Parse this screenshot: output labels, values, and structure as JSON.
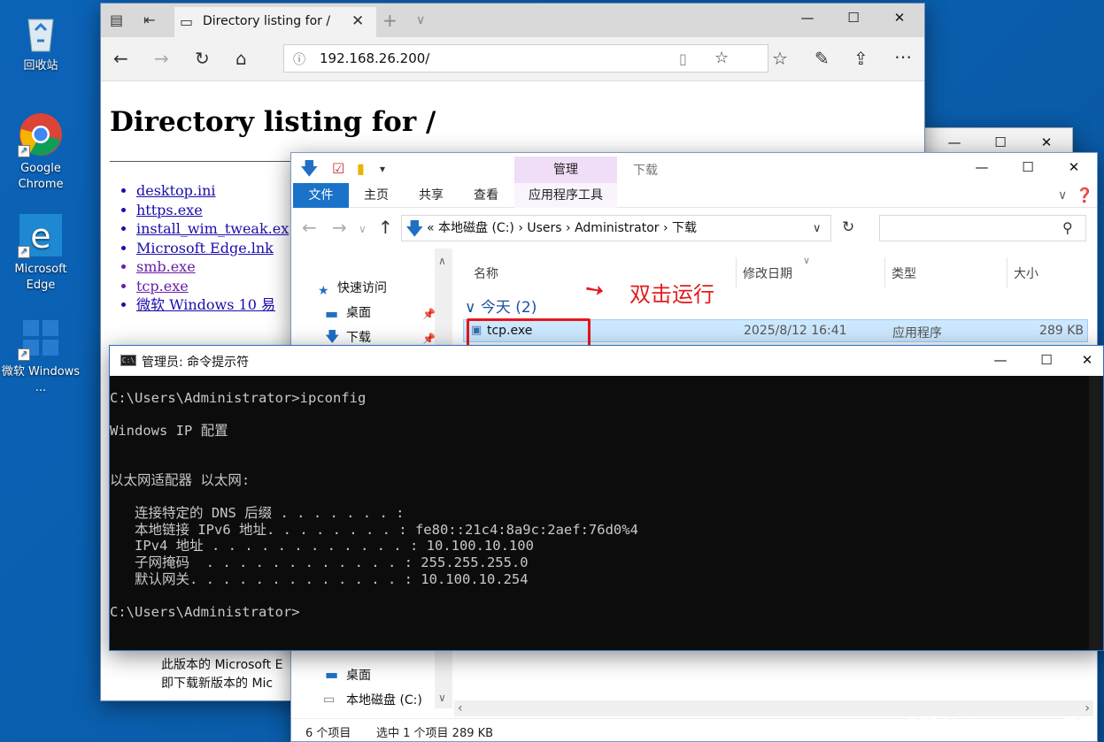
{
  "desktop": {
    "icons": [
      {
        "label": "回收站"
      },
      {
        "label": "Google Chrome"
      },
      {
        "label": "Microsoft Edge"
      },
      {
        "label": "微软 Windows ..."
      }
    ]
  },
  "browser": {
    "tab_title": "Directory listing for /",
    "url": "192.168.26.200/",
    "page": {
      "heading": "Directory listing for /",
      "links": [
        "desktop.ini",
        "https.exe",
        "install_wim_tweak.ex",
        "Microsoft Edge.lnk",
        "smb.exe",
        "tcp.exe",
        "微软 Windows 10 易"
      ],
      "note_line1": "此版本的 Microsoft E",
      "note_line2": "即下载新版本的 Mic"
    }
  },
  "explorer": {
    "ribbon": {
      "manage": "管理",
      "downloads": "下载",
      "file": "文件",
      "home": "主页",
      "share": "共享",
      "view": "查看",
      "app_tools": "应用程序工具"
    },
    "breadcrumb": "« 本地磁盘 (C:)  ›  Users  ›  Administrator  ›  下载",
    "sidebar": {
      "quick_access": "快速访问",
      "desktop": "桌面",
      "downloads": "下载",
      "desktop2": "桌面",
      "local_disk": "本地磁盘 (C:)"
    },
    "columns": {
      "name": "名称",
      "date": "修改日期",
      "type": "类型",
      "size": "大小"
    },
    "group": "今天 (2)",
    "selected_file": {
      "name": "tcp.exe",
      "date": "2025/8/12 16:41",
      "type": "应用程序",
      "size": "289 KB"
    },
    "annotation": "双击运行",
    "status": {
      "count": "6 个项目",
      "selection": "选中 1 个项目  289 KB"
    }
  },
  "cmd": {
    "title": "管理员: 命令提示符",
    "output": "C:\\Users\\Administrator>ipconfig\n\nWindows IP 配置\n\n\n以太网适配器 以太网:\n\n   连接特定的 DNS 后缀 . . . . . . . :\n   本地链接 IPv6 地址. . . . . . . . : fe80::21c4:8a9c:2aef:76d0%4\n   IPv4 地址 . . . . . . . . . . . . : 10.100.10.100\n   子网掩码  . . . . . . . . . . . . : 255.255.255.0\n   默认网关. . . . . . . . . . . . . : 10.100.10.254\n\nC:\\Users\\Administrator>"
  },
  "watermark": "CSDN @mooyuan天天"
}
